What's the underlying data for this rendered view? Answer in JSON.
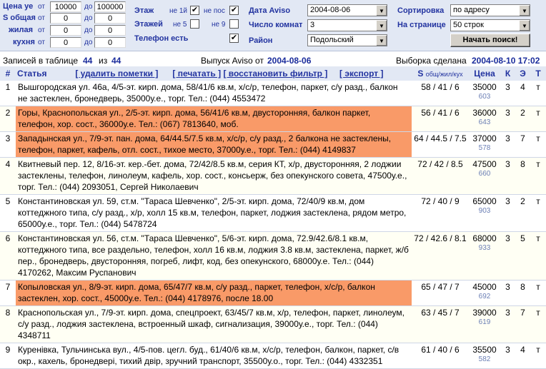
{
  "filters": {
    "price_label": "Цена уе",
    "area_total_label": "S общая",
    "area_living_label": "жилая",
    "area_kitchen_label": "кухня",
    "from_label": "от",
    "to_label": "до",
    "price_from": "10000",
    "price_to": "100000",
    "total_from": "0",
    "total_to": "0",
    "living_from": "0",
    "living_to": "0",
    "kitchen_from": "0",
    "kitchen_to": "0",
    "floor_label": "Этаж",
    "floors_label": "Этажей",
    "phone_label": "Телефон есть",
    "not_first_label": "не 1й",
    "not_last_label": "не пос",
    "not_5_label": "не 5",
    "not_9_label": "не 9",
    "not_first_checked": "✔",
    "not_last_checked": "✔",
    "not_5_checked": "",
    "not_9_checked": "",
    "phone_checked": "✔",
    "date_label": "Дата Aviso",
    "rooms_label": "Число комнат",
    "district_label": "Район",
    "date_value": "2004-08-06",
    "rooms_value": "3",
    "district_value": "Подольский",
    "sort_label": "Сортировка",
    "per_page_label": "На странице",
    "sort_value": "по адресу",
    "per_page_value": "50 строк",
    "search_button": "Начать поиск!"
  },
  "info": {
    "records_label": "Записей в таблице",
    "records_count": "44",
    "of_label": "из",
    "records_total": "44",
    "issue_label": "Выпуск Aviso от",
    "issue_date": "2004-08-06",
    "sample_label": "Выборка сделана",
    "sample_date": "2004-08-10 17:02"
  },
  "table": {
    "headers": {
      "num": "#",
      "article": "Статья",
      "delete_marks": "[ удалить пометки ]",
      "print": "[ печатать ]",
      "restore_filter": "[ восстановить фильтр ]",
      "export": "[ экспорт ]",
      "area": "S",
      "area_sub": "общ/жил/кух",
      "price": "Цена",
      "rooms": "К",
      "floor": "Э",
      "type": "Т"
    },
    "rows": [
      {
        "num": "1",
        "text": "Вышгородская ул. 46а, 4/5-эт. кирп. дома, 58/41/6 кв.м, х/с/р, телефон, паркет, с/у разд., балкон не застеклен, бронедверь, 35000у.е., торг. Тел.: (044) 4553472",
        "area": "58 / 41 / 6",
        "price": "35000",
        "id": "603",
        "rooms": "3",
        "floor": "4",
        "type": "т"
      },
      {
        "num": "2",
        "text": "Горы, Краснопольская ул., 2/5-эт. кирп. дома, 56/41/6 кв.м, двусторонняя, балкон паркет, телефон, хор. сост., 36000у.е. Тел.: (067) 7813640, моб.",
        "area": "56 / 41 / 6",
        "price": "36000",
        "id": "643",
        "rooms": "3",
        "floor": "2",
        "type": "т"
      },
      {
        "num": "3",
        "text": "Западынская ул., 7/9-эт. пан. дома, 64/44.5/7.5 кв.м, х/с/р, с/у разд., 2 балкона не застеклены, телефон, паркет, кафель, отл. сост., тихое место, 37000у.е., торг. Тел.: (044) 4149837",
        "area": "64 / 44.5 / 7.5",
        "price": "37000",
        "id": "578",
        "rooms": "3",
        "floor": "7",
        "type": "т"
      },
      {
        "num": "4",
        "text": "Квитневый пер. 12, 8/16-эт. кер.-бет. дома, 72/42/8.5 кв.м, серия КТ, х/р, двусторонняя, 2 лоджии застеклены, телефон, линолеум, кафель, хор. сост., консьерж, без опекунского совета, 47500у.е., торг. Тел.: (044) 2093051, Сергей Николаевич",
        "area": "72 / 42 / 8.5",
        "price": "47500",
        "id": "660",
        "rooms": "3",
        "floor": "8",
        "type": "т"
      },
      {
        "num": "5",
        "text": "Константиновская ул. 59, ст.м. \"Тараса Шевченко\", 2/5-эт. кирп. дома, 72/40/9 кв.м, дом коттеджного типа, с/у разд., х/р, холл 15 кв.м, телефон, паркет, лоджия застеклена, рядом метро, 65000у.е., торг. Тел.: (044) 5478724",
        "area": "72 / 40 / 9",
        "price": "65000",
        "id": "903",
        "rooms": "3",
        "floor": "2",
        "type": "т"
      },
      {
        "num": "6",
        "text": "Константиновская ул. 56, ст.м. \"Тараса Шевченко\", 5/6-эт. кирп. дома, 72.9/42.6/8.1 кв.м, коттеджного типа, все раздельно, телефон, холл 16 кв.м, лоджия 3.8 кв.м, застеклена, паркет, ж/б пер., бронедверь, двусторонняя, погреб, лифт, код, без опекунского, 68000у.е. Тел.: (044) 4170262, Максим Руспанович",
        "area": "72 / 42.6 / 8.1",
        "price": "68000",
        "id": "933",
        "rooms": "3",
        "floor": "5",
        "type": "т"
      },
      {
        "num": "7",
        "text": "Копыловская ул., 8/9-эт. кирп. дома, 65/47/7 кв.м, с/у разд., паркет, телефон, х/с/р, балкон застеклен, хор. сост., 45000у.е. Тел.: (044) 4178976, после 18.00",
        "area": "65 / 47 / 7",
        "price": "45000",
        "id": "692",
        "rooms": "3",
        "floor": "8",
        "type": "т"
      },
      {
        "num": "8",
        "text": "Краснопольская ул., 7/9-эт. кирп. дома, спецпроект, 63/45/7 кв.м, х/р, телефон, паркет, линолеум, с/у разд., лоджия застеклена, встроенный шкаф, сигнализация, 39000у.е., торг. Тел.: (044) 4348711",
        "area": "63 / 45 / 7",
        "price": "39000",
        "id": "619",
        "rooms": "3",
        "floor": "7",
        "type": "т"
      },
      {
        "num": "9",
        "text": "Куренівка, Тульчинська вул., 4/5-пов. цегл. буд., 61/40/6 кв.м, х/с/р, телефон, балкон, паркет, с/в окр., кахель, бронедвері, тихий двір, зручний транспорт, 35500у.о., торг. Тел.: (044) 4332351",
        "area": "61 / 40 / 6",
        "price": "35500",
        "id": "582",
        "rooms": "3",
        "floor": "4",
        "type": "т"
      }
    ],
    "highlighted_rows": [
      "2",
      "3",
      "7"
    ],
    "highlight_color": "#f99a68"
  }
}
